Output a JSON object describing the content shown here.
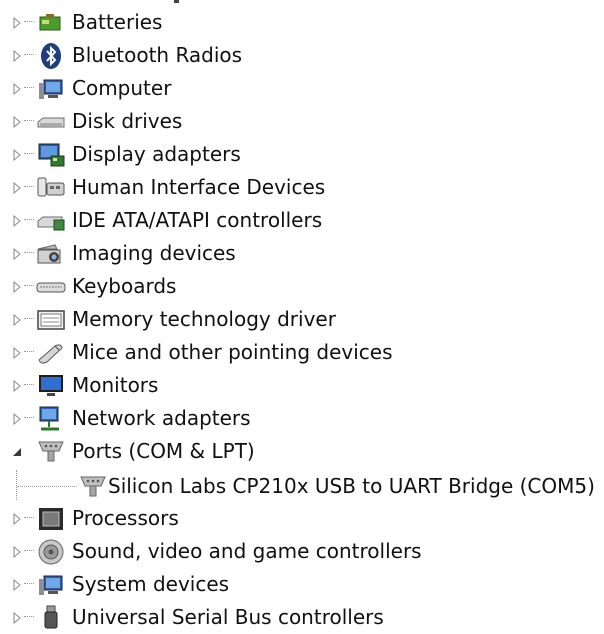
{
  "device_tree": {
    "items": [
      {
        "label": "Batteries",
        "icon": "battery-icon",
        "expanded": false
      },
      {
        "label": "Bluetooth Radios",
        "icon": "bluetooth-icon",
        "expanded": false
      },
      {
        "label": "Computer",
        "icon": "computer-icon",
        "expanded": false
      },
      {
        "label": "Disk drives",
        "icon": "disk-drive-icon",
        "expanded": false
      },
      {
        "label": "Display adapters",
        "icon": "display-adapter-icon",
        "expanded": false
      },
      {
        "label": "Human Interface Devices",
        "icon": "hid-icon",
        "expanded": false
      },
      {
        "label": "IDE ATA/ATAPI controllers",
        "icon": "ide-controller-icon",
        "expanded": false
      },
      {
        "label": "Imaging devices",
        "icon": "camera-icon",
        "expanded": false
      },
      {
        "label": "Keyboards",
        "icon": "keyboard-icon",
        "expanded": false
      },
      {
        "label": "Memory technology driver",
        "icon": "memory-icon",
        "expanded": false
      },
      {
        "label": "Mice and other pointing devices",
        "icon": "mouse-icon",
        "expanded": false
      },
      {
        "label": "Monitors",
        "icon": "monitor-icon",
        "expanded": false
      },
      {
        "label": "Network adapters",
        "icon": "network-icon",
        "expanded": false
      },
      {
        "label": "Ports (COM & LPT)",
        "icon": "port-icon",
        "expanded": true,
        "children": [
          {
            "label": "Silicon Labs CP210x USB to UART Bridge (COM5)",
            "icon": "port-icon"
          }
        ]
      },
      {
        "label": "Processors",
        "icon": "processor-icon",
        "expanded": false
      },
      {
        "label": "Sound, video and game controllers",
        "icon": "speaker-icon",
        "expanded": false
      },
      {
        "label": "System devices",
        "icon": "system-devices-icon",
        "expanded": false
      },
      {
        "label": "Universal Serial Bus controllers",
        "icon": "usb-icon",
        "expanded": false
      }
    ]
  },
  "colors": {
    "tree_line": "#9a9a9a",
    "expander": "#8a8a8a",
    "expanded_arrow": "#3a3a3a"
  }
}
